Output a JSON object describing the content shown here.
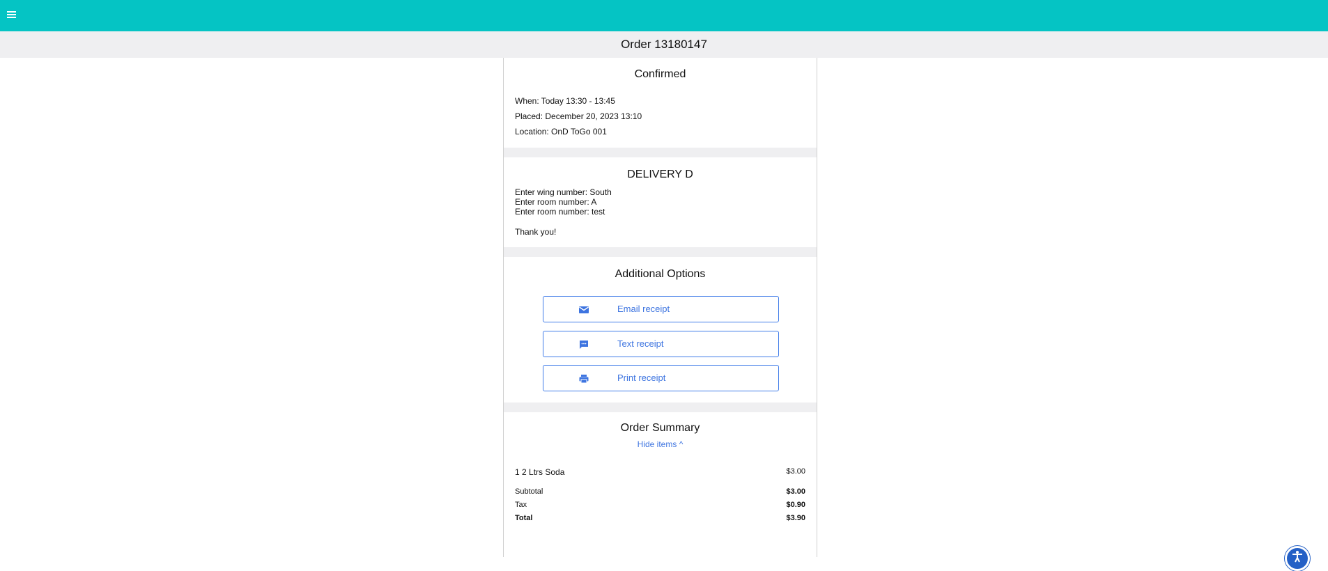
{
  "header": {
    "title": "Order 13180147",
    "menu_icon": "menu-icon",
    "accent_color": "#05c4c4"
  },
  "status": {
    "heading": "Confirmed",
    "when": "When: Today 13:30 - 13:45",
    "placed": "Placed: December 20, 2023 13:10",
    "location": "Location: OnD ToGo 001"
  },
  "delivery": {
    "heading": "DELIVERY D",
    "lines": [
      "Enter wing number: South",
      "Enter room number: A",
      "Enter room number: test"
    ],
    "thanks": "Thank you!"
  },
  "options": {
    "heading": "Additional Options",
    "buttons": [
      {
        "label": "Email receipt",
        "icon": "email-icon"
      },
      {
        "label": "Text receipt",
        "icon": "message-icon"
      },
      {
        "label": "Print receipt",
        "icon": "print-icon"
      }
    ],
    "button_color": "#3d74e0"
  },
  "summary": {
    "heading": "Order Summary",
    "toggle": "Hide items ^",
    "items": [
      {
        "name": "1  2 Ltrs Soda",
        "price": "$3.00"
      }
    ],
    "subtotal_label": "Subtotal",
    "subtotal": "$3.00",
    "tax_label": "Tax",
    "tax": "$0.90",
    "total_label": "Total",
    "total": "$3.90"
  }
}
